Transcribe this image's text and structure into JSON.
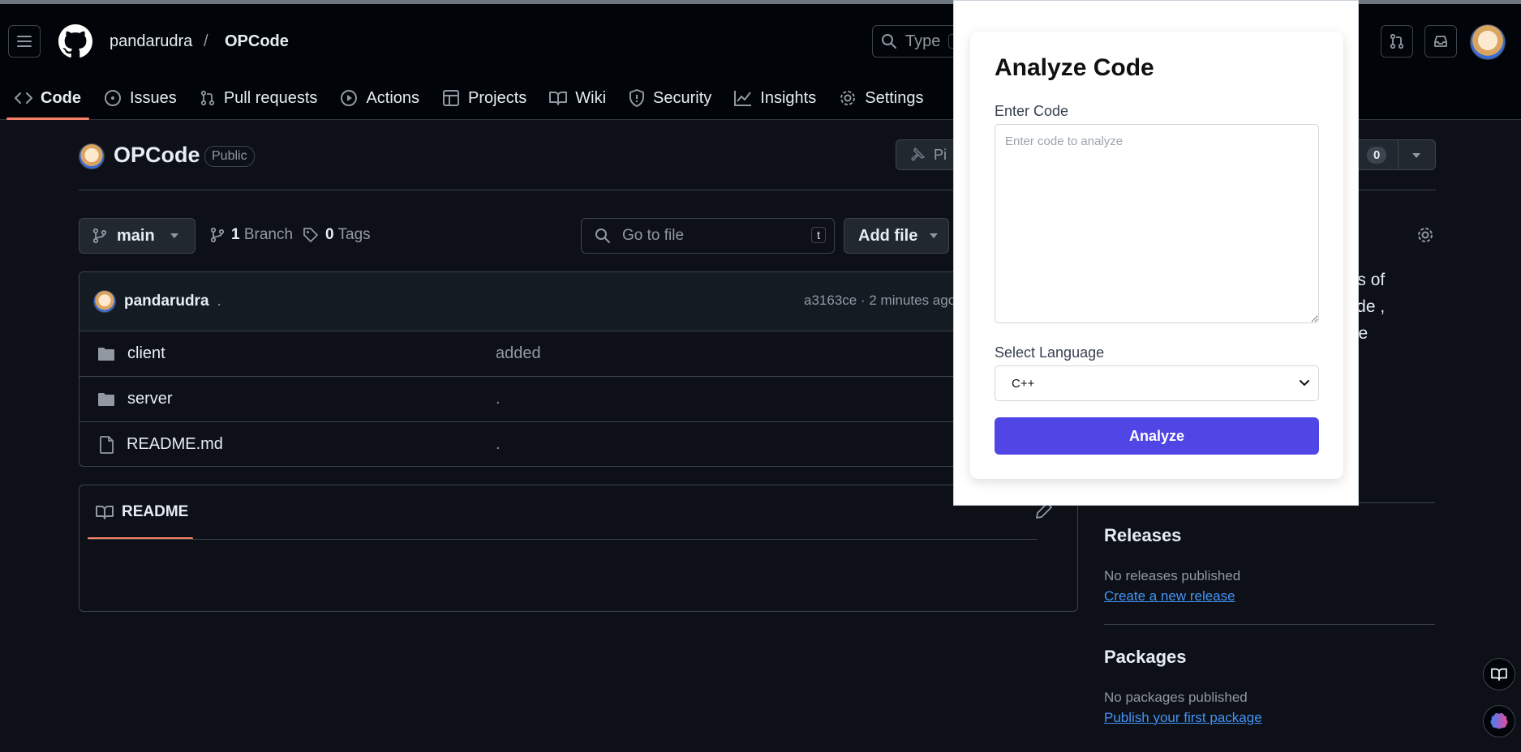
{
  "header": {
    "owner": "pandarudra",
    "separator": "/",
    "repo": "OPCode",
    "search_placeholder": "Type",
    "search_key": "/"
  },
  "nav": {
    "tabs": [
      {
        "label": "Code",
        "icon": "code-icon",
        "active": true
      },
      {
        "label": "Issues",
        "icon": "issue-icon"
      },
      {
        "label": "Pull requests",
        "icon": "pull-request-icon"
      },
      {
        "label": "Actions",
        "icon": "play-icon"
      },
      {
        "label": "Projects",
        "icon": "table-icon"
      },
      {
        "label": "Wiki",
        "icon": "book-icon"
      },
      {
        "label": "Security",
        "icon": "shield-icon"
      },
      {
        "label": "Insights",
        "icon": "graph-icon"
      },
      {
        "label": "Settings",
        "icon": "gear-icon"
      }
    ]
  },
  "repo_header": {
    "name": "OPCode",
    "visibility": "Public",
    "pin_label": "Pi",
    "star_count": "0"
  },
  "toolbar": {
    "branch": "main",
    "branch_count": "1",
    "branch_label": "Branch",
    "tag_count": "0",
    "tag_label": "Tags",
    "goto_placeholder": "Go to file",
    "goto_key": "t",
    "add_file": "Add file"
  },
  "commit": {
    "author": "pandarudra",
    "message": ".",
    "sha": "a3163ce",
    "sep": "·",
    "time": "2 minutes ago"
  },
  "files": [
    {
      "name": "client",
      "type": "folder",
      "message": "added"
    },
    {
      "name": "server",
      "type": "folder",
      "message": "."
    },
    {
      "name": "README.md",
      "type": "file",
      "message": "."
    }
  ],
  "readme": {
    "tab_label": "README"
  },
  "sidebar": {
    "about_fragments": [
      "des of",
      "code ,",
      "free"
    ],
    "releases": {
      "title": "Releases",
      "text": "No releases published",
      "link": "Create a new release"
    },
    "packages": {
      "title": "Packages",
      "text": "No packages published",
      "link": "Publish your first package"
    }
  },
  "popup": {
    "title": "Analyze Code",
    "code_label": "Enter Code",
    "code_placeholder": "Enter code to analyze",
    "code_value": "",
    "lang_label": "Select Language",
    "lang_selected": "C++",
    "analyze_button": "Analyze"
  },
  "colors": {
    "background": "#0d1117",
    "header_bg": "#010409",
    "accent_underline": "#f78166",
    "link": "#4493f8",
    "analyze_button": "#4f46e5"
  }
}
